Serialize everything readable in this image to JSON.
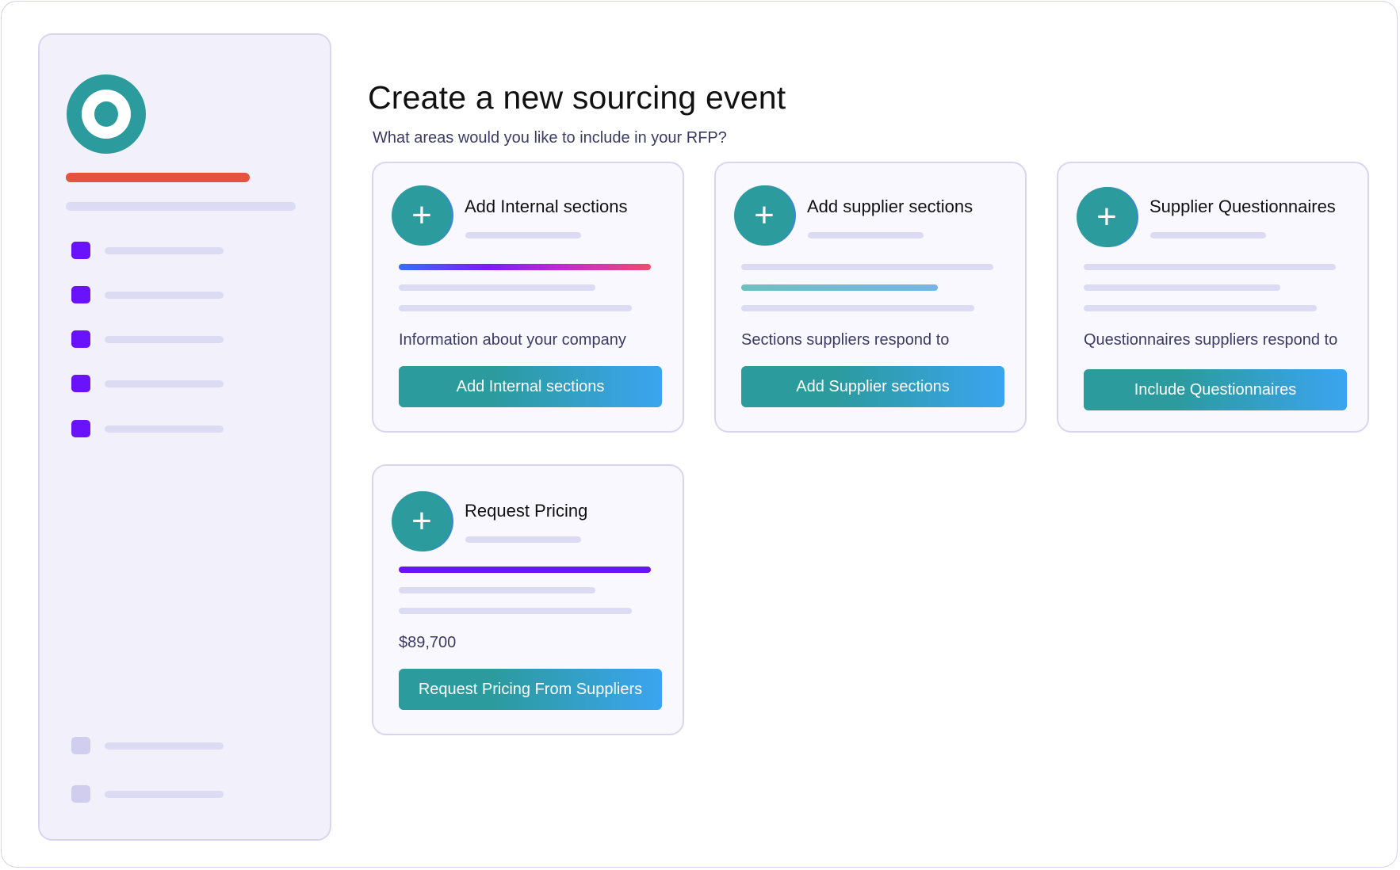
{
  "header": {
    "title": "Create a new sourcing event",
    "subtitle": "What areas would you like to include in your RFP?"
  },
  "colors": {
    "brand_teal": "#2b9b9d",
    "accent_red": "#e4533d",
    "nav_purple": "#6a13fa",
    "button_gradient_end": "#3ba4f0"
  },
  "sidebar": {
    "logo_icon": "ring-logo-icon",
    "nav_item_count_top": 5,
    "nav_item_count_bottom": 2
  },
  "cards": [
    {
      "icon": "plus-icon",
      "title": "Add Internal sections",
      "description": "Information about your company",
      "button_label": "Add Internal sections"
    },
    {
      "icon": "plus-icon",
      "title": "Add supplier sections",
      "description": "Sections suppliers respond to",
      "button_label": "Add Supplier sections"
    },
    {
      "icon": "plus-icon",
      "title": "Supplier Questionnaires",
      "description": "Questionnaires suppliers respond to",
      "button_label": "Include Questionnaires"
    },
    {
      "icon": "plus-icon",
      "title": "Request Pricing",
      "description": "$89,700",
      "button_label": "Request Pricing From Suppliers"
    }
  ]
}
